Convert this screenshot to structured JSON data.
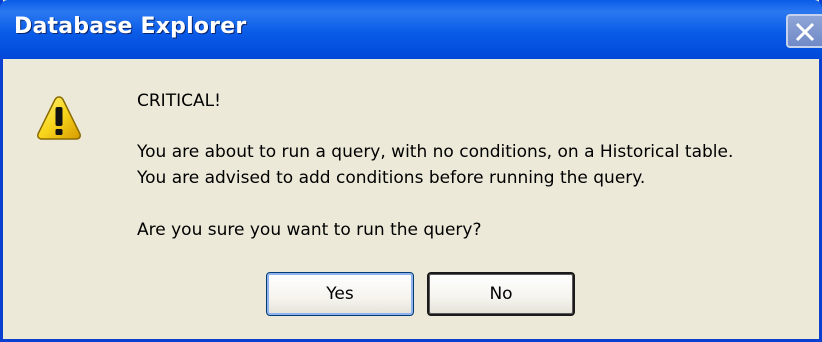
{
  "window": {
    "title": "Database Explorer",
    "title_color": "#ffffff",
    "titlebar_color": "#0a5ce8",
    "body_color": "#ece9d8"
  },
  "icon": {
    "name": "warning-icon",
    "color": "#f8d51c"
  },
  "message": {
    "heading": "CRITICAL!",
    "line1": "You are about to run a query, with no conditions, on a Historical table.",
    "line2": "You are advised to add conditions before running the query.",
    "question": "Are you sure you want to run the query?"
  },
  "buttons": {
    "yes_label": "Yes",
    "no_label": "No"
  }
}
